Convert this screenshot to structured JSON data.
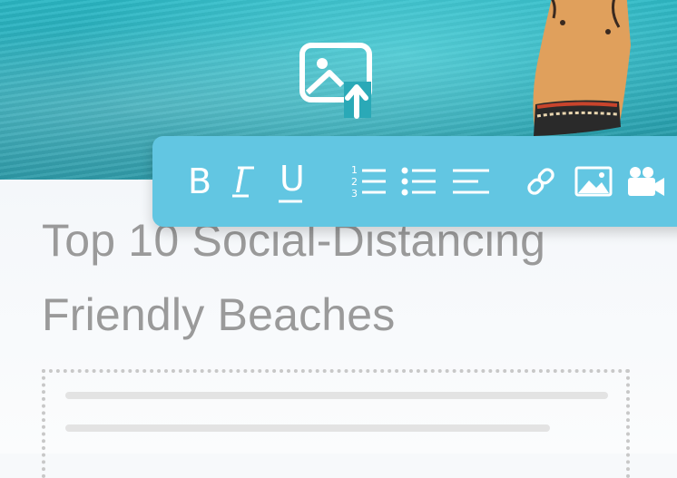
{
  "article": {
    "title": "Top 10 Social-Distancing Friendly Beaches"
  },
  "hero": {
    "upload_icon": "image-upload-icon"
  },
  "toolbar": {
    "bold_label": "B",
    "italic_label": "I",
    "underline_label": "U",
    "buttons": [
      {
        "name": "bold",
        "icon": "bold-icon"
      },
      {
        "name": "italic",
        "icon": "italic-icon"
      },
      {
        "name": "underline",
        "icon": "underline-icon"
      },
      {
        "name": "numbered-list",
        "icon": "numbered-list-icon"
      },
      {
        "name": "bullet-list",
        "icon": "bullet-list-icon"
      },
      {
        "name": "align-left",
        "icon": "align-left-icon"
      },
      {
        "name": "link",
        "icon": "link-icon"
      },
      {
        "name": "image",
        "icon": "image-icon"
      },
      {
        "name": "video",
        "icon": "video-camera-icon"
      }
    ]
  },
  "colors": {
    "toolbar": "#62c6e2",
    "title_text": "#9a9a9a",
    "water": "#2aa9b7"
  }
}
